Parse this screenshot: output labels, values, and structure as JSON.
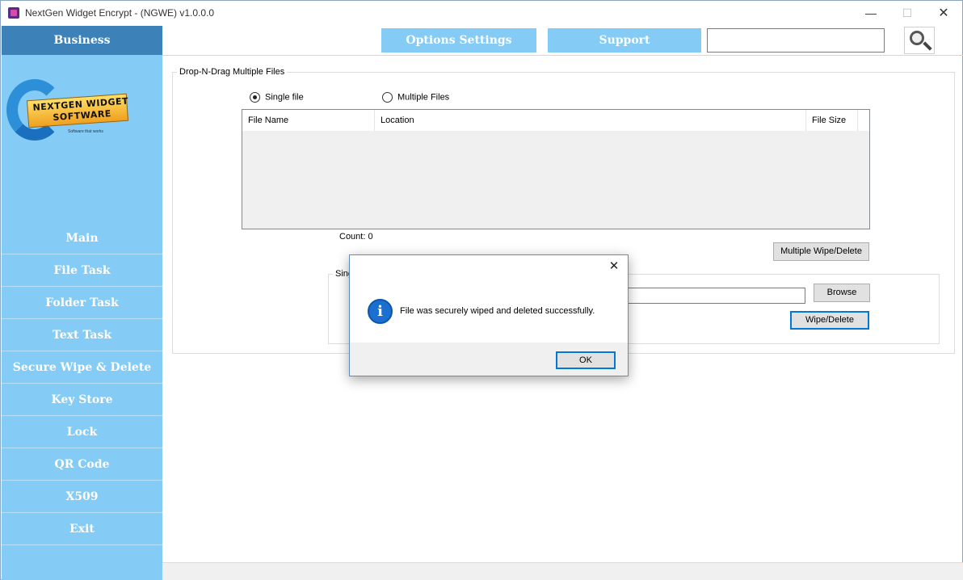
{
  "window": {
    "title": "NextGen Widget Encrypt - (NGWE) v1.0.0.0",
    "minimize_glyph": "—",
    "maximize_glyph": "☐",
    "close_glyph": "✕"
  },
  "sidebar": {
    "header": "Business",
    "logo": {
      "line1": "NEXTGEN WIDGET",
      "line2": "SOFTWARE",
      "tagline": "Software that works"
    },
    "items": [
      {
        "label": "Main"
      },
      {
        "label": "File Task"
      },
      {
        "label": "Folder Task"
      },
      {
        "label": "Text Task"
      },
      {
        "label": "Secure Wipe & Delete"
      },
      {
        "label": "Key Store"
      },
      {
        "label": "Lock"
      },
      {
        "label": "QR Code"
      },
      {
        "label": "X509"
      },
      {
        "label": "Exit"
      }
    ],
    "colors": {
      "background": "#84cbf5",
      "header": "#3c82b8"
    }
  },
  "toolbar": {
    "options_label": "Options Settings",
    "support_label": "Support",
    "search_value": "",
    "search_icon": "magnifier-icon"
  },
  "multi_files": {
    "legend": "Drop-N-Drag Multiple Files",
    "radio_single": "Single file",
    "radio_multiple": "Multiple Files",
    "selected_mode": "Single file",
    "columns": [
      "File Name",
      "Location",
      "File Size"
    ],
    "rows": [],
    "count_label": "Count:",
    "count_value": "0",
    "multi_wipe_label": "Multiple Wipe/Delete"
  },
  "single_file": {
    "legend": "Sing",
    "path_value": "",
    "browse_label": "Browse",
    "wipe_label": "Wipe/Delete"
  },
  "dialog": {
    "icon": "info-icon",
    "icon_glyph": "i",
    "message": "File was securely wiped and deleted successfully.",
    "ok_label": "OK",
    "close_glyph": "✕"
  }
}
